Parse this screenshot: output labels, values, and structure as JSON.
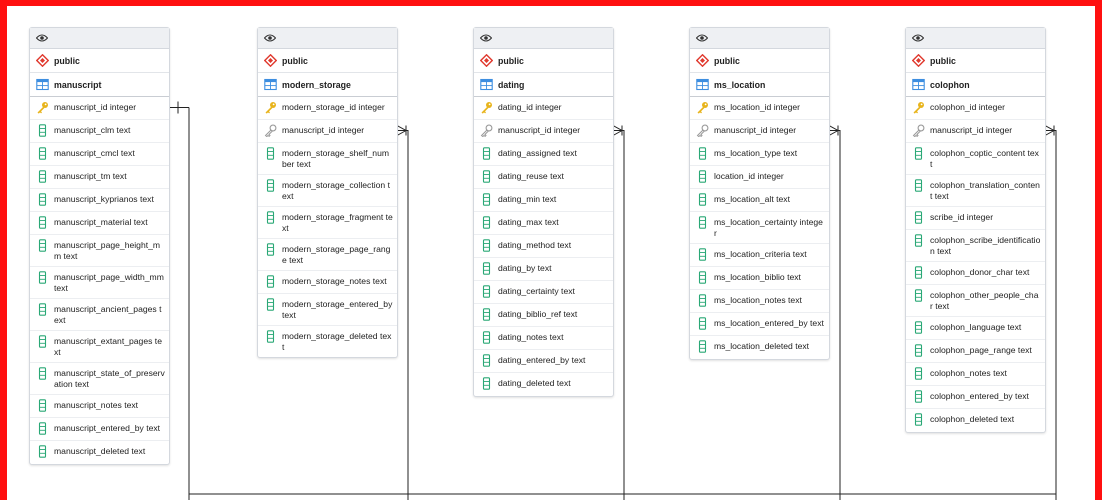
{
  "tables": [
    {
      "schema": "public",
      "name": "manuscript",
      "columns": [
        {
          "label": "manuscript_id integer",
          "kind": "pk"
        },
        {
          "label": "manuscript_clm text",
          "kind": "col"
        },
        {
          "label": "manuscript_cmcl text",
          "kind": "col"
        },
        {
          "label": "manuscript_tm text",
          "kind": "col"
        },
        {
          "label": "manuscript_kyprianos text",
          "kind": "col"
        },
        {
          "label": "manuscript_material text",
          "kind": "col"
        },
        {
          "label": "manuscript_page_height_mm text",
          "kind": "col"
        },
        {
          "label": "manuscript_page_width_mm text",
          "kind": "col"
        },
        {
          "label": "manuscript_ancient_pages text",
          "kind": "col"
        },
        {
          "label": "manuscript_extant_pages text",
          "kind": "col"
        },
        {
          "label": "manuscript_state_of_preservation text",
          "kind": "col"
        },
        {
          "label": "manuscript_notes text",
          "kind": "col"
        },
        {
          "label": "manuscript_entered_by text",
          "kind": "col"
        },
        {
          "label": "manuscript_deleted text",
          "kind": "col"
        }
      ]
    },
    {
      "schema": "public",
      "name": "modern_storage",
      "columns": [
        {
          "label": "modern_storage_id integer",
          "kind": "pk"
        },
        {
          "label": "manuscript_id integer",
          "kind": "fk"
        },
        {
          "label": "modern_storage_shelf_number text",
          "kind": "col"
        },
        {
          "label": "modern_storage_collection text",
          "kind": "col"
        },
        {
          "label": "modern_storage_fragment text",
          "kind": "col"
        },
        {
          "label": "modern_storage_page_range text",
          "kind": "col"
        },
        {
          "label": "modern_storage_notes text",
          "kind": "col"
        },
        {
          "label": "modern_storage_entered_by text",
          "kind": "col"
        },
        {
          "label": "modern_storage_deleted text",
          "kind": "col"
        }
      ]
    },
    {
      "schema": "public",
      "name": "dating",
      "columns": [
        {
          "label": "dating_id integer",
          "kind": "pk"
        },
        {
          "label": "manuscript_id integer",
          "kind": "fk"
        },
        {
          "label": "dating_assigned text",
          "kind": "col"
        },
        {
          "label": "dating_reuse text",
          "kind": "col"
        },
        {
          "label": "dating_min text",
          "kind": "col"
        },
        {
          "label": "dating_max text",
          "kind": "col"
        },
        {
          "label": "dating_method text",
          "kind": "col"
        },
        {
          "label": "dating_by text",
          "kind": "col"
        },
        {
          "label": "dating_certainty text",
          "kind": "col"
        },
        {
          "label": "dating_biblio_ref text",
          "kind": "col"
        },
        {
          "label": "dating_notes text",
          "kind": "col"
        },
        {
          "label": "dating_entered_by text",
          "kind": "col"
        },
        {
          "label": "dating_deleted text",
          "kind": "col"
        }
      ]
    },
    {
      "schema": "public",
      "name": "ms_location",
      "columns": [
        {
          "label": "ms_location_id integer",
          "kind": "pk"
        },
        {
          "label": "manuscript_id integer",
          "kind": "fk"
        },
        {
          "label": "ms_location_type text",
          "kind": "col"
        },
        {
          "label": "location_id integer",
          "kind": "col"
        },
        {
          "label": "ms_location_alt text",
          "kind": "col"
        },
        {
          "label": "ms_location_certainty integer",
          "kind": "col"
        },
        {
          "label": "ms_location_criteria text",
          "kind": "col"
        },
        {
          "label": "ms_location_biblio text",
          "kind": "col"
        },
        {
          "label": "ms_location_notes text",
          "kind": "col"
        },
        {
          "label": "ms_location_entered_by text",
          "kind": "col"
        },
        {
          "label": "ms_location_deleted text",
          "kind": "col"
        }
      ]
    },
    {
      "schema": "public",
      "name": "colophon",
      "columns": [
        {
          "label": "colophon_id integer",
          "kind": "pk"
        },
        {
          "label": "manuscript_id integer",
          "kind": "fk"
        },
        {
          "label": "colophon_coptic_content text",
          "kind": "col"
        },
        {
          "label": "colophon_translation_content text",
          "kind": "col"
        },
        {
          "label": "scribe_id integer",
          "kind": "col"
        },
        {
          "label": "colophon_scribe_identification text",
          "kind": "col"
        },
        {
          "label": "colophon_donor_char text",
          "kind": "col"
        },
        {
          "label": "colophon_other_people_char text",
          "kind": "col"
        },
        {
          "label": "colophon_language text",
          "kind": "col"
        },
        {
          "label": "colophon_page_range text",
          "kind": "col"
        },
        {
          "label": "colophon_notes text",
          "kind": "col"
        },
        {
          "label": "colophon_entered_by text",
          "kind": "col"
        },
        {
          "label": "colophon_deleted text",
          "kind": "col"
        }
      ]
    }
  ],
  "icons": {
    "view": "eye-icon",
    "schema": "schema-icon",
    "table": "table-icon",
    "primary_key": "primary-key-icon",
    "foreign_key": "foreign-key-icon",
    "column": "column-icon"
  },
  "colors": {
    "frame": "#ff1010",
    "schema_icon": "#e0392e",
    "table_icon": "#3d8ee0",
    "primary_key": "#e8b41c",
    "foreign_key": "#9a9a9a",
    "column_icon": "#2aa876",
    "line": "#222222"
  }
}
